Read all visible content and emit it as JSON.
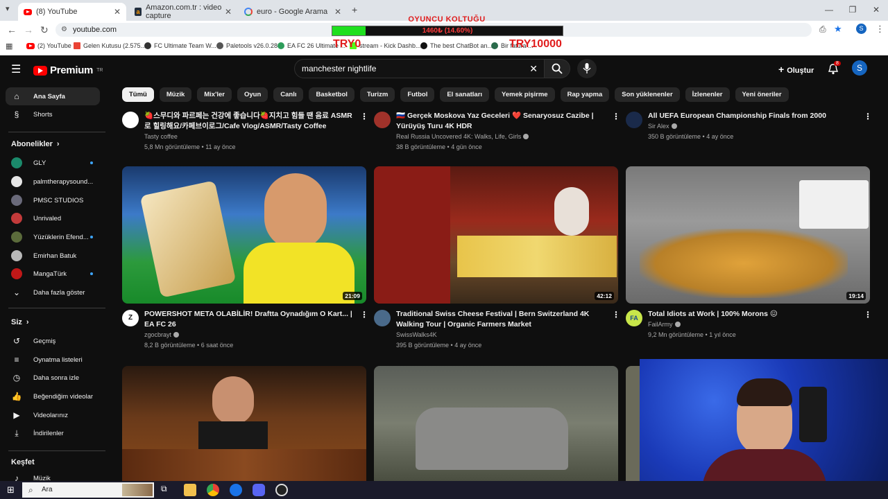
{
  "browser": {
    "tabs": [
      {
        "title": "(8) YouTube",
        "icon": "youtube-favicon",
        "active": true
      },
      {
        "title": "Amazon.com.tr : video capture",
        "icon": "amazon-favicon",
        "active": false
      },
      {
        "title": "euro - Google Arama",
        "icon": "google-favicon",
        "active": false
      }
    ],
    "new_tab": "+",
    "url": "youtube.com",
    "bookmarks": [
      "(2) YouTube",
      "Gelen Kutusu (2.575...",
      "FC Ultimate Team W...",
      "Paletools v26.0.28",
      "EA FC 26 Ultimate ...",
      "stream - Kick Dashb...",
      "The best ChatBot an...",
      "Bir fatura ..."
    ]
  },
  "overlay": {
    "title": "OYUNCU KOLTUĞU",
    "progress_text": "1460₺ (14.60%)",
    "progress_fraction": 0.146,
    "min_label": "TRY0",
    "max_label": "TRY10000",
    "color": "#e01c1c",
    "fill_color": "#1fe01f"
  },
  "youtube": {
    "logo_word": "Premium",
    "logo_sup": "TR",
    "search_query": "manchester nightlife",
    "create_label": "Oluştur",
    "notif_count": "8",
    "avatar_letter": "S",
    "chips": [
      "Tümü",
      "Müzik",
      "Mix'ler",
      "Oyun",
      "Canlı",
      "Basketbol",
      "Turizm",
      "Futbol",
      "El sanatları",
      "Yemek pişirme",
      "Rap yapma",
      "Son yüklenenler",
      "İzlenenler",
      "Yeni öneriler"
    ],
    "sidebar": {
      "main": [
        {
          "label": "Ana Sayfa",
          "icon": "home-icon"
        },
        {
          "label": "Shorts",
          "icon": "shorts-icon"
        }
      ],
      "subs_header": "Abonelikler",
      "subs": [
        {
          "label": "GLY",
          "dot": true,
          "color": "#1b8a6b"
        },
        {
          "label": "palmtherapysound...",
          "dot": false,
          "color": "#e6e6e6"
        },
        {
          "label": "PMSC STUDIOS",
          "dot": false,
          "color": "#6a6a7a"
        },
        {
          "label": "Unrivaled",
          "dot": false,
          "color": "#c23a3a"
        },
        {
          "label": "Yüzüklerin Efend...",
          "dot": true,
          "color": "#5b6b3b"
        },
        {
          "label": "Emirhan Batuk",
          "dot": false,
          "color": "#b8b8b8"
        },
        {
          "label": "MangaTürk",
          "dot": true,
          "color": "#c01818"
        }
      ],
      "show_more": "Daha fazla göster",
      "you_header": "Siz",
      "you": [
        {
          "label": "Geçmiş",
          "icon": "history-icon"
        },
        {
          "label": "Oynatma listeleri",
          "icon": "playlists-icon"
        },
        {
          "label": "Daha sonra izle",
          "icon": "watch-later-icon"
        },
        {
          "label": "Beğendiğim videolar",
          "icon": "like-icon"
        },
        {
          "label": "Videolarınız",
          "icon": "your-videos-icon"
        },
        {
          "label": "İndirilenler",
          "icon": "download-icon"
        }
      ],
      "explore_header": "Keşfet",
      "explore": [
        {
          "label": "Müzik",
          "icon": "music-icon"
        }
      ]
    },
    "videos_top": [
      {
        "title": "🍓스무디와 파르페는 건강에 좋습니다🍓지치고 힘들 땐 음료 ASMR로 힐링해요/카페브이로그/Cafe Vlog/ASMR/Tasty Coffee",
        "channel": "Tasty coffee",
        "verified": false,
        "meta": "5,8 Mn görüntüleme • 11 ay önce"
      },
      {
        "title": "🇷🇺 Gerçek Moskova Yaz Geceleri ❤️ Senaryosuz Cazibe | Yürüyüş Turu 4K HDR",
        "channel": "Real Russia Uncovered 4K: Walks, Life, Girls",
        "verified": true,
        "meta": "38 B görüntüleme • 4 gün önce"
      },
      {
        "title": "All UEFA European Championship Finals from 2000",
        "channel": "Sir Alex",
        "verified": true,
        "meta": "350 B görüntüleme • 4 ay önce"
      }
    ],
    "videos_mid": [
      {
        "title": "POWERSHOT META OLABİLİR! Draftta Oynadığım O Kart... | EA FC 26",
        "channel": "zgocbrayt",
        "verified": true,
        "meta": "8,2 B görüntüleme • 6 saat önce",
        "duration": "21:09"
      },
      {
        "title": "Traditional Swiss Cheese Festival | Bern Switzerland 4K Walking Tour | Organic Farmers Market",
        "channel": "SwissWalks4K",
        "verified": false,
        "meta": "395 B görüntüleme • 4 ay önce",
        "duration": "42:12"
      },
      {
        "title": "Total Idiots at Work | 100% Morons 😖",
        "channel": "FailArmy",
        "verified": true,
        "meta": "9,2 Mn görüntüleme • 1 yıl önce",
        "duration": "19:14"
      }
    ]
  },
  "taskbar": {
    "search_placeholder": "Ara"
  }
}
